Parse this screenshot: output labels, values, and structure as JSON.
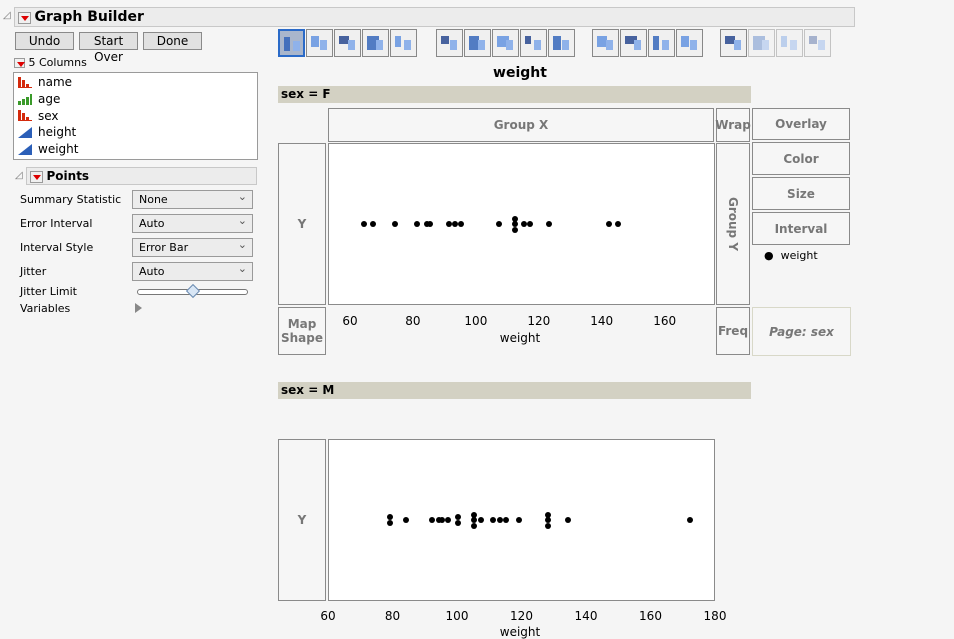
{
  "window": {
    "title": "Graph Builder"
  },
  "buttons": {
    "undo": "Undo",
    "start_over": "Start Over",
    "done": "Done"
  },
  "columns": {
    "header": "5 Columns",
    "items": [
      {
        "name": "name",
        "type": "nominal",
        "color": "#d42a0c"
      },
      {
        "name": "age",
        "type": "ordinal",
        "color": "#3a9a2a"
      },
      {
        "name": "sex",
        "type": "nominal",
        "color": "#d42a0c"
      },
      {
        "name": "height",
        "type": "continuous",
        "color": "#2b5fb8"
      },
      {
        "name": "weight",
        "type": "continuous",
        "color": "#2b5fb8"
      }
    ]
  },
  "points_panel": {
    "title": "Points",
    "summary_statistic": {
      "label": "Summary Statistic",
      "value": "None"
    },
    "error_interval": {
      "label": "Error Interval",
      "value": "Auto"
    },
    "interval_style": {
      "label": "Interval Style",
      "value": "Error Bar"
    },
    "jitter": {
      "label": "Jitter",
      "value": "Auto"
    },
    "jitter_limit": {
      "label": "Jitter Limit",
      "value": 0.5
    },
    "variables": {
      "label": "Variables"
    }
  },
  "toolbar": [
    "points",
    "smoother",
    "line-of-fit",
    "ellipse",
    "contour",
    "line",
    "bar",
    "area",
    "box-plot",
    "histogram",
    "heatmap",
    "pie",
    "treemap",
    "mosaic",
    "caption-box",
    "formula",
    "map-shapes",
    "parallel"
  ],
  "graph": {
    "title": "weight",
    "zones": {
      "group_x": "Group X",
      "wrap": "Wrap",
      "overlay": "Overlay",
      "color": "Color",
      "size": "Size",
      "interval": "Interval",
      "group_y": "Group Y",
      "y": "Y",
      "map_shape": "Map Shape",
      "freq": "Freq",
      "page": "Page: sex"
    },
    "legend": {
      "label": "weight"
    }
  },
  "chart_data": [
    {
      "type": "scatter",
      "title": "sex = F",
      "xlabel": "weight",
      "xlim": [
        53,
        176
      ],
      "xticks": [
        "60",
        "80",
        "100",
        "120",
        "140",
        "160"
      ],
      "values": [
        64,
        67,
        74,
        81,
        84,
        85,
        91,
        93,
        95,
        107,
        112,
        112,
        112,
        115,
        117,
        123,
        142,
        145
      ]
    },
    {
      "type": "scatter",
      "title": "sex = M",
      "xlabel": "weight",
      "xlim": [
        60,
        180
      ],
      "xticks": [
        "60",
        "80",
        "100",
        "120",
        "140",
        "160",
        "180"
      ],
      "values": [
        79,
        79,
        84,
        92,
        94,
        95,
        97,
        100,
        100,
        105,
        105,
        105,
        107,
        111,
        113,
        115,
        119,
        128,
        128,
        128,
        134,
        172
      ]
    }
  ]
}
